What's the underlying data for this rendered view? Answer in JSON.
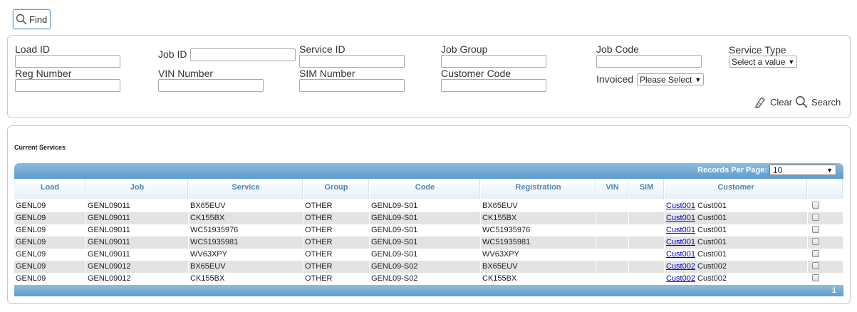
{
  "toolbar": {
    "find_label": "Find"
  },
  "search": {
    "fields": {
      "load_id": {
        "label": "Load ID",
        "value": ""
      },
      "job_id": {
        "label": "Job ID",
        "value": ""
      },
      "service_id": {
        "label": "Service ID",
        "value": ""
      },
      "job_group": {
        "label": "Job Group",
        "value": ""
      },
      "job_code": {
        "label": "Job Code",
        "value": ""
      },
      "service_type": {
        "label": "Service Type",
        "selected": "Select a value"
      },
      "reg_number": {
        "label": "Reg Number",
        "value": ""
      },
      "vin_number": {
        "label": "VIN Number",
        "value": ""
      },
      "sim_number": {
        "label": "SIM Number",
        "value": ""
      },
      "customer_code": {
        "label": "Customer Code",
        "value": ""
      },
      "invoiced": {
        "label": "Invoiced",
        "selected": "Please Select"
      }
    },
    "clear_label": "Clear",
    "search_label": "Search"
  },
  "services": {
    "title": "Current Services",
    "records_per_page_label": "Records Per Page:",
    "records_per_page": "10",
    "columns": {
      "load": "Load",
      "job": "Job",
      "service": "Service",
      "group": "Group",
      "code": "Code",
      "registration": "Registration",
      "vin": "VIN",
      "sim": "SIM",
      "customer": "Customer"
    },
    "rows": [
      {
        "load": "GENL09",
        "job": "GENL09011",
        "service": "BX65EUV",
        "group": "OTHER",
        "code": "GENL09-S01",
        "registration": "BX65EUV",
        "vin": "",
        "sim": "",
        "customer_link": "Cust001",
        "customer_name": "Cust001"
      },
      {
        "load": "GENL09",
        "job": "GENL09011",
        "service": "CK155BX",
        "group": "OTHER",
        "code": "GENL09-S01",
        "registration": "CK155BX",
        "vin": "",
        "sim": "",
        "customer_link": "Cust001",
        "customer_name": "Cust001"
      },
      {
        "load": "GENL09",
        "job": "GENL09011",
        "service": "WC51935976",
        "group": "OTHER",
        "code": "GENL09-S01",
        "registration": "WC51935976",
        "vin": "",
        "sim": "",
        "customer_link": "Cust001",
        "customer_name": "Cust001"
      },
      {
        "load": "GENL09",
        "job": "GENL09011",
        "service": "WC51935981",
        "group": "OTHER",
        "code": "GENL09-S01",
        "registration": "WC51935981",
        "vin": "",
        "sim": "",
        "customer_link": "Cust001",
        "customer_name": "Cust001"
      },
      {
        "load": "GENL09",
        "job": "GENL09011",
        "service": "WV63XPY",
        "group": "OTHER",
        "code": "GENL09-S01",
        "registration": "WV63XPY",
        "vin": "",
        "sim": "",
        "customer_link": "Cust001",
        "customer_name": "Cust001"
      },
      {
        "load": "GENL09",
        "job": "GENL09012",
        "service": "BX65EUV",
        "group": "OTHER",
        "code": "GENL09-S02",
        "registration": "BX65EUV",
        "vin": "",
        "sim": "",
        "customer_link": "Cust002",
        "customer_name": "Cust002"
      },
      {
        "load": "GENL09",
        "job": "GENL09012",
        "service": "CK155BX",
        "group": "OTHER",
        "code": "GENL09-S02",
        "registration": "CK155BX",
        "vin": "",
        "sim": "",
        "customer_link": "Cust002",
        "customer_name": "Cust002"
      }
    ],
    "page_number": "1"
  },
  "icons": {
    "find": "magnifier-icon",
    "clear": "eraser-icon",
    "search": "magnifier-icon",
    "select_caret": "caret-down-icon"
  },
  "colors": {
    "grid_header_blue": "#5e9bcc",
    "header_text": "#4f86b6",
    "link": "#0000cc",
    "alt_row": "#e3e3e3",
    "panel_border": "#b8cad6"
  }
}
